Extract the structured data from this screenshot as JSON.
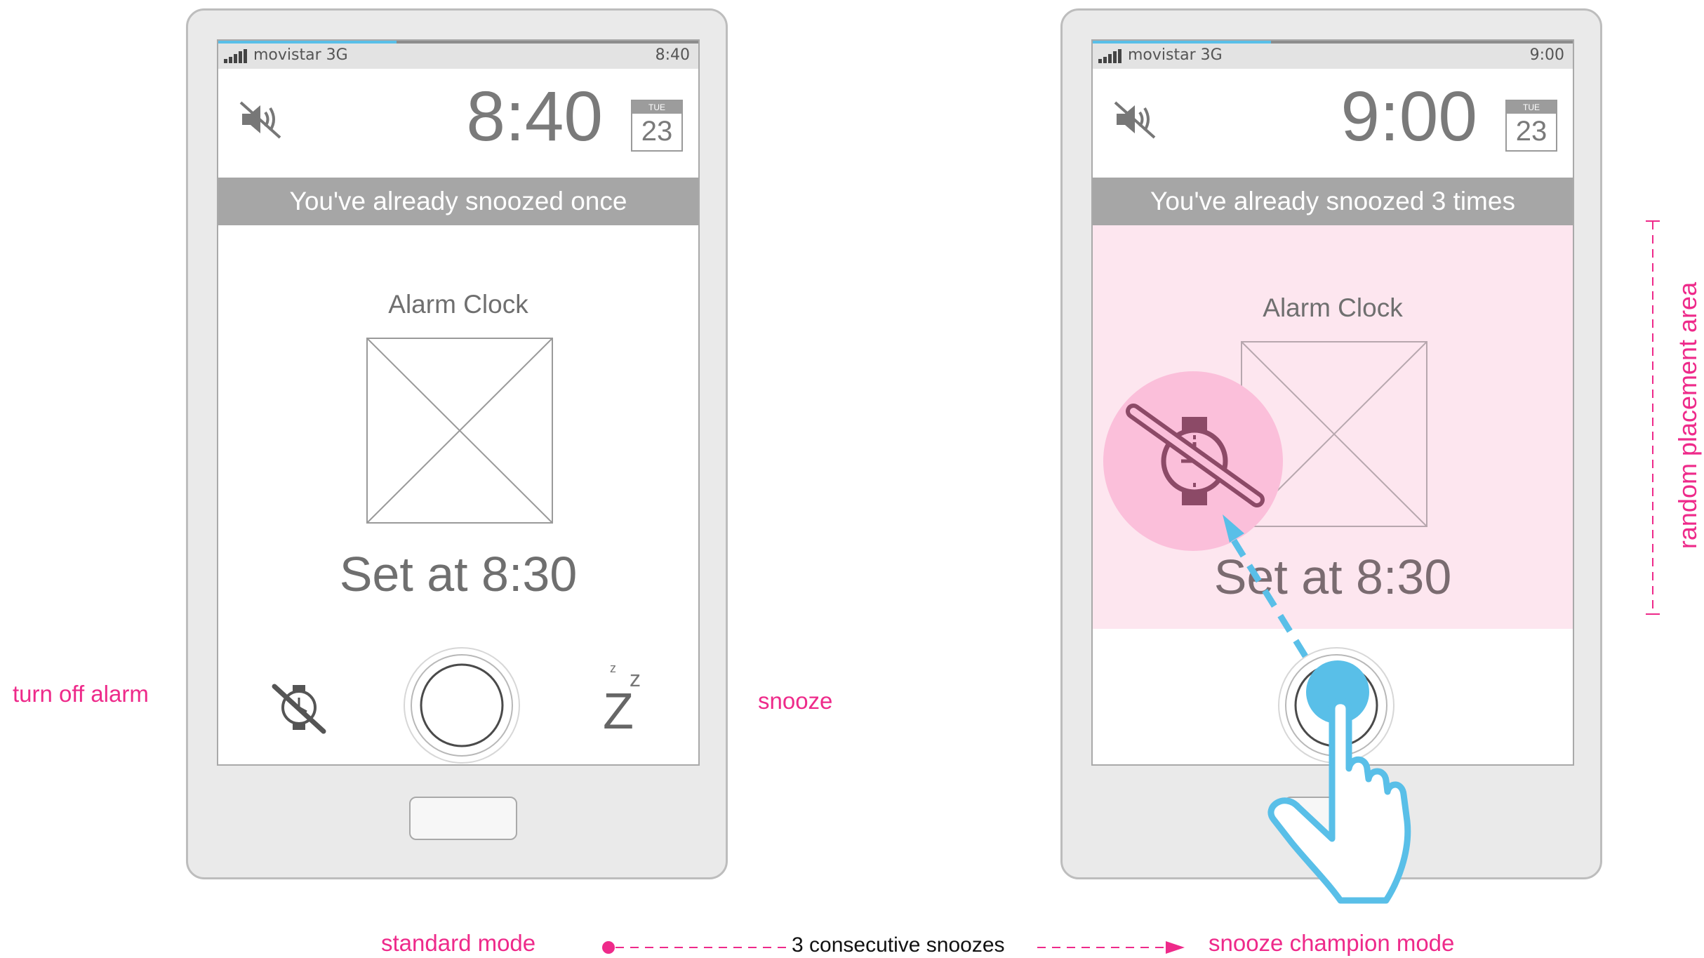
{
  "colors": {
    "accent_pink": "#ee2a8a",
    "highlight_blue": "#59bfe8",
    "pink_zone": "#fde6ef"
  },
  "standard_phone": {
    "carrier": "movistar 3G",
    "status_time": "8:40",
    "clock": "8:40",
    "calendar_dow": "TUE",
    "calendar_day": "23",
    "banner": "You've already snoozed once",
    "alarm_title": "Alarm Clock",
    "set_at": "Set at 8:30",
    "icons": [
      "mute-icon",
      "alarm-off-icon",
      "dismiss-ring-button",
      "snooze-zzz-icon"
    ],
    "snooze_glyph": "Z"
  },
  "champion_phone": {
    "carrier": "movistar 3G",
    "status_time": "9:00",
    "clock": "9:00",
    "calendar_dow": "TUE",
    "calendar_day": "23",
    "banner": "You've already snoozed 3 times",
    "alarm_title": "Alarm Clock",
    "set_at": "Set at 8:30",
    "icons": [
      "mute-icon",
      "alarm-off-icon",
      "touch-hand-icon",
      "drag-arrow-icon"
    ]
  },
  "annotations": {
    "turn_off_alarm": "turn off alarm",
    "snooze": "snooze",
    "random_placement_area": "random placement area",
    "standard_mode": "standard mode",
    "transition": "3 consecutive snoozes",
    "snooze_champion_mode": "snooze champion mode"
  }
}
